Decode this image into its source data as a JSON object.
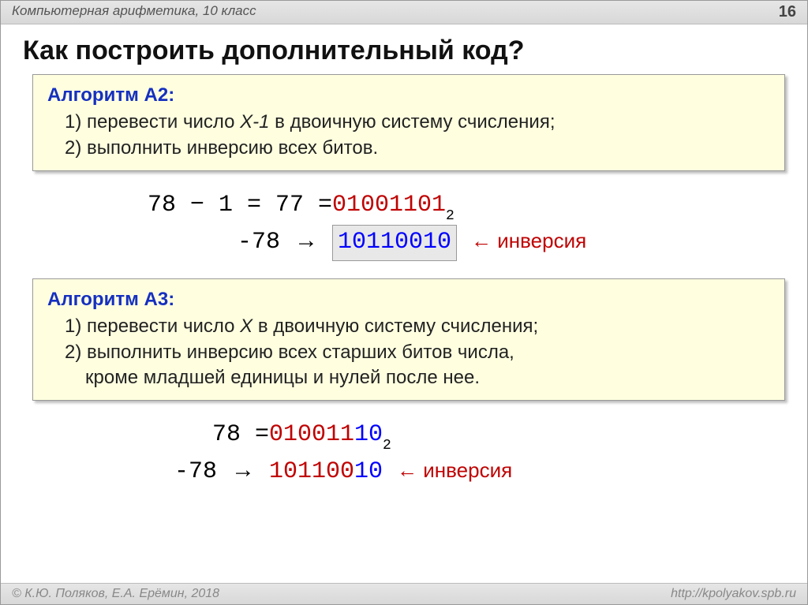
{
  "header": {
    "course": "Компьютерная арифметика, 10 класс",
    "page": "16"
  },
  "title": "Как построить дополнительный код?",
  "algoA2": {
    "title": "Алгоритм А2:",
    "line1_pre": "1) перевести число ",
    "line1_var": "X-1",
    "line1_post": " в двоичную систему счисления;",
    "line2": "2) выполнить инверсию всех битов."
  },
  "calc1": {
    "row1_lhs": "78 − 1 = 77 = ",
    "row1_lead": "0",
    "row1_bits": "1001101",
    "row1_sub": "2",
    "row2_lhs": "-78 ",
    "row2_arrow": "→",
    "row2_result": "10110010",
    "row2_label_arrow": "←",
    "row2_label": " инверсия"
  },
  "algoA3": {
    "title": "Алгоритм А3:",
    "line1_pre": "1) перевести число ",
    "line1_var": "X",
    "line1_post": " в двоичную систему счисления;",
    "line2": "2) выполнить инверсию всех старших битов числа,",
    "line3": "кроме младшей единицы и нулей после нее."
  },
  "calc2": {
    "row1_lhs": " 78 = ",
    "row1_lead": "0",
    "row1_bits_red": "10011",
    "row1_bits_blue": "10",
    "row1_sub": "2",
    "row2_lhs": "-78 ",
    "row2_arrow": "→",
    "row2_bits_red": "101100",
    "row2_bits_blue": "10",
    "row2_label_arrow": "←",
    "row2_label": " инверсия"
  },
  "footer": {
    "copyright": "© К.Ю. Поляков, Е.А. Ерёмин, 2018",
    "url": "http://kpolyakov.spb.ru"
  }
}
